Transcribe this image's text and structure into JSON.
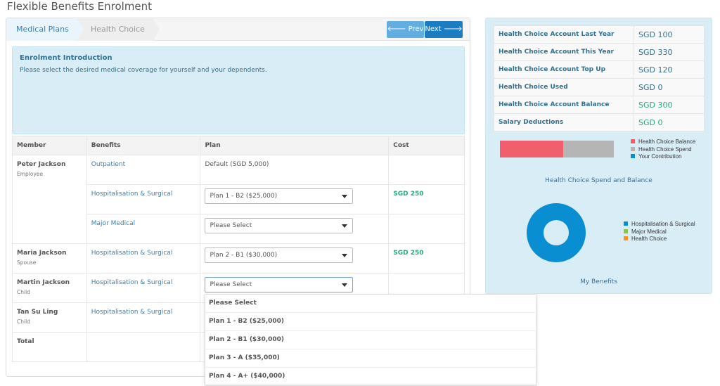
{
  "page_title": "Flexible Benefits Enrolment",
  "wizard": {
    "steps": [
      "Medical Plans",
      "Health Choice"
    ],
    "prev_label": "Prev",
    "next_label": "Next"
  },
  "intro": {
    "title": "Enrolment Introduction",
    "text": "Please select the desired medical coverage for yourself and your dependents."
  },
  "table": {
    "headers": [
      "Member",
      "Benefits",
      "Plan",
      "Cost"
    ],
    "rows": [
      {
        "member": "Peter Jackson",
        "role": "Employee",
        "benefit": "Outpatient",
        "plan": "Default (SGD 5,000)",
        "cost": ""
      },
      {
        "benefit": "Hospitalisation & Surgical",
        "plan_select": "Plan 1 - B2 ($25,000)",
        "cost": "SGD 250"
      },
      {
        "benefit": "Major Medical",
        "plan_select": "Please Select",
        "cost": ""
      },
      {
        "member": "Maria Jackson",
        "role": "Spouse",
        "benefit": "Hospitalisation & Surgical",
        "plan_select": "Plan 2 - B1 ($30,000)",
        "cost": "SGD 250"
      },
      {
        "member": "Martin Jackson",
        "role": "Child",
        "benefit": "Hospitalisation & Surgical",
        "plan_select": "Please Select",
        "cost": ""
      },
      {
        "member": "Tan Su Ling",
        "role": "Child",
        "benefit": "Hospitalisation & Surgical",
        "plan_select": "",
        "cost": ""
      }
    ],
    "total_label": "Total"
  },
  "dropdown_options": [
    "Please Select",
    "Plan 1 - B2 ($25,000)",
    "Plan 2 - B1 ($30,000)",
    "Plan 3 - A ($35,000)",
    "Plan 4 - A+ ($40,000)"
  ],
  "summary": [
    {
      "label": "Health Choice Account Last Year",
      "value": "SGD 100"
    },
    {
      "label": "Health Choice Account This Year",
      "value": "SGD 330"
    },
    {
      "label": "Health Choice Account Top Up",
      "value": "SGD 120"
    },
    {
      "label": "Health Choice Used",
      "value": "SGD 0"
    },
    {
      "label": "Health Choice Account Balance",
      "value": "SGD 300"
    },
    {
      "label": "Salary Deductions",
      "value": "SGD 0"
    }
  ],
  "chart_data": [
    {
      "type": "bar",
      "title": "Health Choice Spend and Balance",
      "stacked": true,
      "orientation": "horizontal",
      "legend_position": "right",
      "series": [
        {
          "name": "Health Choice Balance",
          "percent": 55.6,
          "color": "#ef5f6c"
        },
        {
          "name": "Health Choice Spend",
          "percent": 44.4,
          "color": "#b5b5b5"
        },
        {
          "name": "Your Contribution",
          "percent": 0,
          "color": "#0a8ed2"
        }
      ]
    },
    {
      "type": "pie",
      "donut": true,
      "title": "My Benefits",
      "legend_position": "right",
      "series": [
        {
          "name": "Hospitalisation & Surgical",
          "percent": 100,
          "color": "#0a8ed2"
        },
        {
          "name": "Major Medical",
          "percent": 0,
          "color": "#8cc63f"
        },
        {
          "name": "Health Choice",
          "percent": 0,
          "color": "#f7941d"
        }
      ]
    }
  ]
}
